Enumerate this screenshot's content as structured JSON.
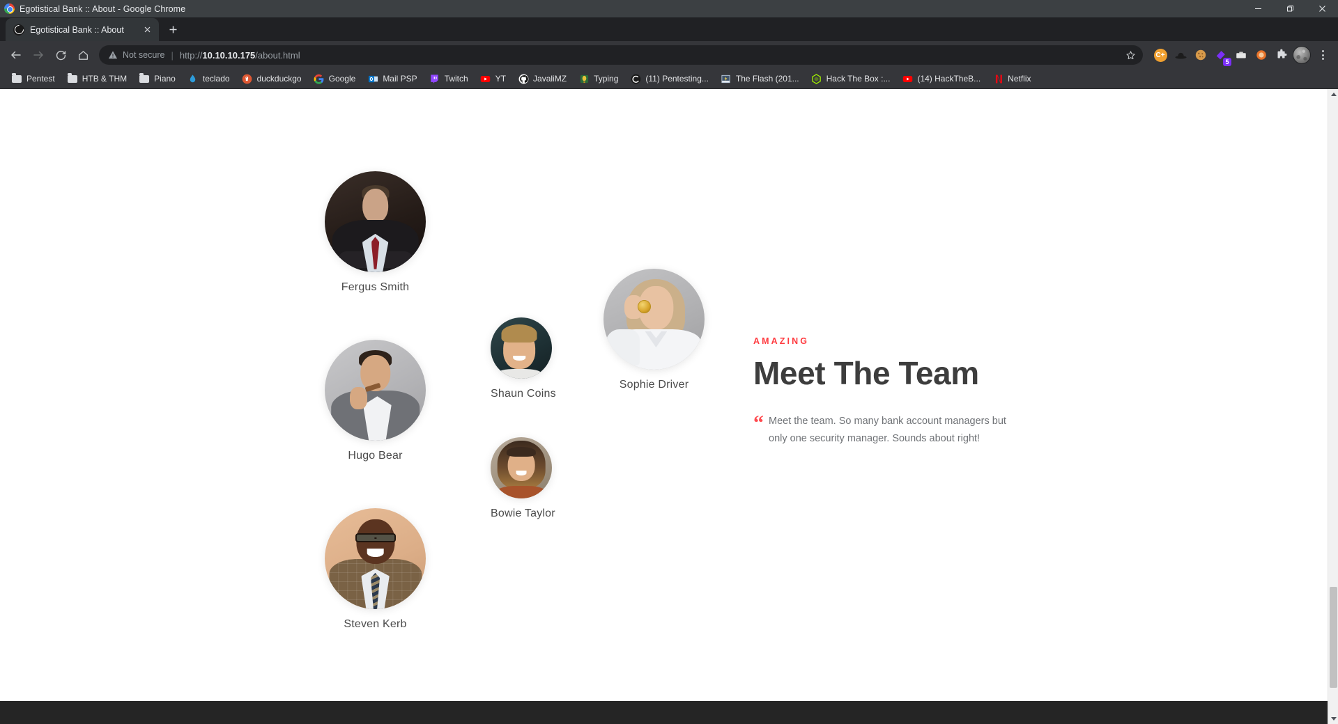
{
  "window": {
    "title": "Egotistical Bank :: About - Google Chrome",
    "controls": {
      "minimize": "minimize",
      "maximize": "restore",
      "close": "close"
    }
  },
  "tabs": [
    {
      "title": "Egotistical Bank :: About",
      "favicon": "globe-icon",
      "active": true
    }
  ],
  "newtab_label": "+",
  "toolbar": {
    "back": "back-icon",
    "forward": "forward-icon",
    "reload": "reload-icon",
    "home": "home-icon",
    "security_text": "Not secure",
    "separator": "|",
    "url_scheme": "http://",
    "url_host": "10.10.10.175",
    "url_path": "/about.html",
    "url_full": "http://10.10.10.175/about.html",
    "bookmark_star": "star-icon",
    "extensions": [
      {
        "name": "c-plus-extension",
        "glyph": "C+",
        "color": "#f0a030"
      },
      {
        "name": "black-hat-extension",
        "glyph": "◠",
        "color": "#1c1c1c"
      },
      {
        "name": "cookie-extension",
        "glyph": "●",
        "color": "#d79a4a"
      },
      {
        "name": "purple-notes-extension",
        "glyph": "◆",
        "color": "#7b2ff7",
        "badge": "5"
      },
      {
        "name": "briefcase-extension",
        "glyph": "▭",
        "color": "#dcdcdc"
      },
      {
        "name": "orange-circle-extension",
        "glyph": "●",
        "color": "#e8732a"
      },
      {
        "name": "puzzle-extensions-menu",
        "glyph": "❖",
        "color": "#dadce0"
      }
    ],
    "profile": "avatar",
    "menu": "three-dot-menu-icon"
  },
  "bookmarks": [
    {
      "label": "Pentest",
      "icon": "folder-icon",
      "type": "folder"
    },
    {
      "label": "HTB & THM",
      "icon": "folder-icon",
      "type": "folder"
    },
    {
      "label": "Piano",
      "icon": "folder-icon",
      "type": "folder"
    },
    {
      "label": "teclado",
      "icon": "drop-icon",
      "type": "site",
      "color": "#2d9cdb",
      "glyph": "●"
    },
    {
      "label": "duckduckgo",
      "icon": "duckduckgo-icon",
      "type": "site",
      "color": "#de5833",
      "glyph": "●"
    },
    {
      "label": "Google",
      "icon": "google-icon",
      "type": "site",
      "color": "#ffffff",
      "glyph": "G"
    },
    {
      "label": "Mail PSP",
      "icon": "outlook-icon",
      "type": "site",
      "color": "#0072c6",
      "glyph": "O"
    },
    {
      "label": "Twitch",
      "icon": "twitch-icon",
      "type": "site",
      "color": "#9146ff",
      "glyph": "▮"
    },
    {
      "label": "YT",
      "icon": "youtube-icon",
      "type": "site",
      "color": "#ff0000",
      "glyph": "▶"
    },
    {
      "label": "JavaliMZ",
      "icon": "github-icon",
      "type": "site",
      "color": "#ffffff",
      "glyph": "●"
    },
    {
      "label": "Typing",
      "icon": "typing-icon",
      "type": "site",
      "color": "#2b6b3a",
      "glyph": "●"
    },
    {
      "label": "(11) Pentesting...",
      "icon": "globe-icon",
      "type": "site",
      "color": "#1a1a1a",
      "glyph": "●"
    },
    {
      "label": "The Flash (201...",
      "icon": "flash-icon",
      "type": "site",
      "color": "#8ca0b8",
      "glyph": "■"
    },
    {
      "label": "Hack The Box :...",
      "icon": "hackthebox-icon",
      "type": "site",
      "color": "#9fef00",
      "glyph": "⬢"
    },
    {
      "label": "(14) HackTheB...",
      "icon": "youtube-icon",
      "type": "site",
      "color": "#ff0000",
      "glyph": "▶"
    },
    {
      "label": "Netflix",
      "icon": "netflix-icon",
      "type": "site",
      "color": "#e50914",
      "glyph": "N"
    }
  ],
  "page": {
    "eyebrow": "AMAZING",
    "headline": "Meet The Team",
    "quote_mark": "“",
    "quote": "Meet the team. So many bank account managers but only one security manager. Sounds about right!",
    "accent_color": "#ff3b40",
    "heading_color": "#3d3d3d",
    "body_color": "#6f7276",
    "team": [
      {
        "name": "Fergus Smith",
        "photo": "p-fergus"
      },
      {
        "name": "Shaun Coins",
        "photo": "p-shaun"
      },
      {
        "name": "Hugo Bear",
        "photo": "p-hugo"
      },
      {
        "name": "Bowie Taylor",
        "photo": "p-bowie"
      },
      {
        "name": "Sophie Driver",
        "photo": "p-sophie"
      },
      {
        "name": "Steven Kerb",
        "photo": "p-steven"
      }
    ]
  },
  "scrollbar": {
    "up": "scroll-up-arrow",
    "down": "scroll-down-arrow"
  }
}
